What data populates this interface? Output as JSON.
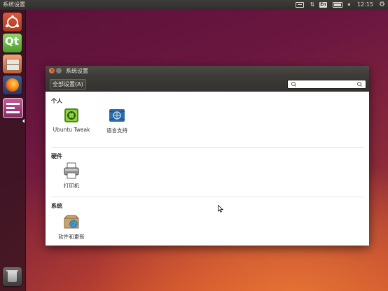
{
  "top_panel": {
    "title": "系统设置",
    "time": "12:15",
    "lang": "En"
  },
  "launcher": {
    "items": [
      "dash",
      "qt-creator",
      "files",
      "firefox",
      "system-settings"
    ],
    "qt_label": "Qt"
  },
  "window": {
    "title": "系统设置",
    "all_settings_label": "全部设置(A)",
    "search_placeholder": "",
    "sections": [
      {
        "title": "个人",
        "items": [
          {
            "label": "Ubuntu Tweak"
          },
          {
            "label": "语言支持"
          }
        ]
      },
      {
        "title": "硬件",
        "items": [
          {
            "label": "打印机"
          }
        ]
      },
      {
        "title": "系统",
        "items": [
          {
            "label": "软件和更新"
          }
        ]
      }
    ]
  },
  "colors": {
    "panel": "#3c3b37",
    "accent": "#df4a22"
  }
}
